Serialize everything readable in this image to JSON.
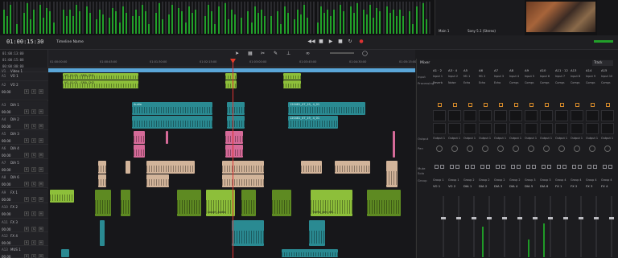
{
  "header": {
    "timecode": "01:00:15:30",
    "timeline_name": "Timeline Name",
    "timecode_small": [
      "01:00:13:00",
      "01:00:15:08",
      "00:00:00:00"
    ]
  },
  "ruler": {
    "ticks": [
      "01:00:00:00",
      "01:00:45:00",
      "01:01:30:00",
      "01:02:15:00",
      "01:03:00:00",
      "01:03:45:00",
      "01:04:30:00",
      "01:05:15:00"
    ]
  },
  "tracks": [
    {
      "id": "V1",
      "name": "Video 1",
      "value": ""
    },
    {
      "id": "A1",
      "name": "VO 1",
      "value": "00.00"
    },
    {
      "id": "A2",
      "name": "VO 2",
      "value": "00.00"
    },
    {
      "id": "A3",
      "name": "DIA 1",
      "value": "00.00"
    },
    {
      "id": "A4",
      "name": "DIA 2",
      "value": "00.00"
    },
    {
      "id": "A5",
      "name": "DIA 3",
      "value": "00.00"
    },
    {
      "id": "A6",
      "name": "DIA 4",
      "value": "00.00"
    },
    {
      "id": "A7",
      "name": "DIA 5",
      "value": "00.00"
    },
    {
      "id": "A8",
      "name": "DIA 6",
      "value": "00.00"
    },
    {
      "id": "A9",
      "name": "FX 1",
      "value": "00.00"
    },
    {
      "id": "A10",
      "name": "FX 2",
      "value": "00.00"
    },
    {
      "id": "A11",
      "name": "FX 3",
      "value": "00.00"
    },
    {
      "id": "A12",
      "name": "FX 4",
      "value": "00.00"
    },
    {
      "id": "A13",
      "name": "MUS 1",
      "value": "00.00"
    }
  ],
  "track_buttons": [
    "R",
    "S",
    "M"
  ],
  "clips": {
    "vo1": "VO_01.01 - SMA_CH1",
    "vo2": "VO_01.01 - SMA_CH2",
    "audio": "Audio",
    "dia1": "120481_07_19_ 4_01",
    "dia2": "120481_07_19_ 4_01",
    "fx": "Lough_Audio",
    "traffic": "Traffic_jam_aft..."
  },
  "monitor": {
    "main": "Main 1",
    "format": "Sony 5.1 (Stereo)"
  },
  "mixer": {
    "title": "Mixer",
    "track_dropdown": "Track",
    "row_labels": [
      "Input",
      "Processing",
      "Output",
      "Pan",
      "Mute",
      "Solo",
      "Group"
    ],
    "columns": [
      {
        "head": "A1 · 2",
        "input": "Input 1",
        "proc": "Reverb",
        "output": "Output 1",
        "group": "Group 1",
        "name": "VO 1"
      },
      {
        "head": "A3 · 4",
        "input": "Input 2",
        "proc": "Noise",
        "output": "Output 1",
        "group": "Group 1",
        "name": "VO 2"
      },
      {
        "head": "A5",
        "input": "M1 1",
        "proc": "Echo",
        "output": "Output 1",
        "group": "Group 2",
        "name": "DIA 1"
      },
      {
        "head": "A6",
        "input": "M1 2",
        "proc": "Echo",
        "output": "Output 1",
        "group": "Group 2",
        "name": "DIA 2"
      },
      {
        "head": "A7",
        "input": "Input 3",
        "proc": "Echo",
        "output": "Output 1",
        "group": "Group 2",
        "name": "DIA 3"
      },
      {
        "head": "A8",
        "input": "Input 4",
        "proc": "Compr.",
        "output": "Output 1",
        "group": "Group 2",
        "name": "DIA 4"
      },
      {
        "head": "A9",
        "input": "Input 5",
        "proc": "Compr.",
        "output": "Output 1",
        "group": "Group 3",
        "name": "DIA 5"
      },
      {
        "head": "A10",
        "input": "Input 6",
        "proc": "Compr.",
        "output": "Output 1",
        "group": "Group 3",
        "name": "DIA 6"
      },
      {
        "head": "A11 · 12",
        "input": "Input 7",
        "proc": "Compr.",
        "output": "Output 1",
        "group": "Group 4",
        "name": "FX 1"
      },
      {
        "head": "A13",
        "input": "Input 8",
        "proc": "Compr.",
        "output": "Output 1",
        "group": "Group 4",
        "name": "FX 2"
      },
      {
        "head": "A14",
        "input": "Input 9",
        "proc": "Compr.",
        "output": "Output 1",
        "group": "Group 4",
        "name": "FX 3"
      },
      {
        "head": "A15",
        "input": "Input 10",
        "proc": "Compr.",
        "output": "Output 1",
        "group": "Group 4",
        "name": "FX 4"
      }
    ]
  },
  "colors": {
    "playhead": "#e23a2a",
    "video_track": "#5aa6d8",
    "clip_green": "#8dbf3a",
    "clip_teal": "#2a8a92",
    "clip_pink": "#d56a98",
    "clip_beige": "#d2b49a",
    "meter_green": "#22a02a"
  }
}
